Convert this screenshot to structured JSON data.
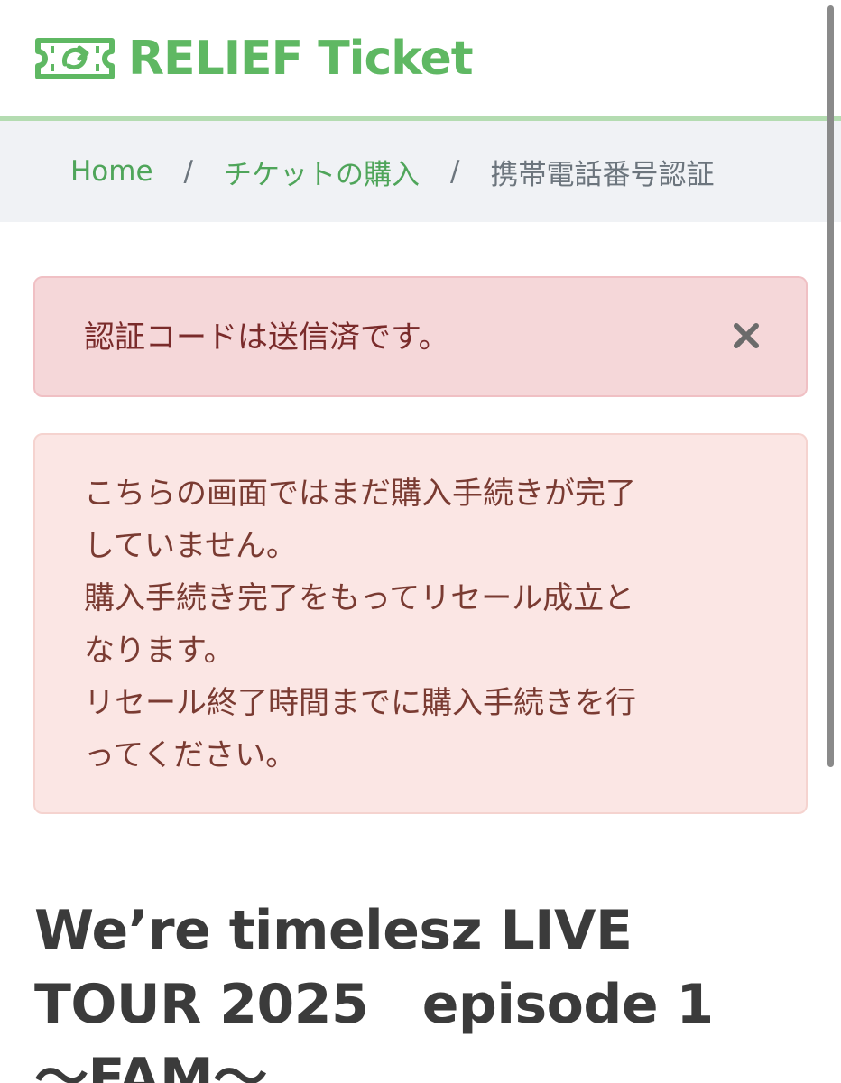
{
  "header": {
    "logo_text": "RELIEF Ticket",
    "logo_icon": "ticket-arrow-icon",
    "brand_color": "#5fb863"
  },
  "breadcrumb": {
    "home": "Home",
    "separator": "/",
    "purchase": "チケットの購入",
    "current": "携帯電話番号認証"
  },
  "alert_sent": {
    "message": "認証コードは送信済です。",
    "close_icon": "close-icon"
  },
  "notice": {
    "lines": [
      "こちらの画面ではまだ購入手続きが完了",
      "していません。",
      "購入手続き完了をもってリセール成立と",
      "なります。",
      "リセール終了時間までに購入手続きを行",
      "ってください。"
    ]
  },
  "event": {
    "title_lines": [
      "We’re timelesz LIVE",
      "TOUR 2025　episode 1",
      "〜FAM〜"
    ]
  }
}
